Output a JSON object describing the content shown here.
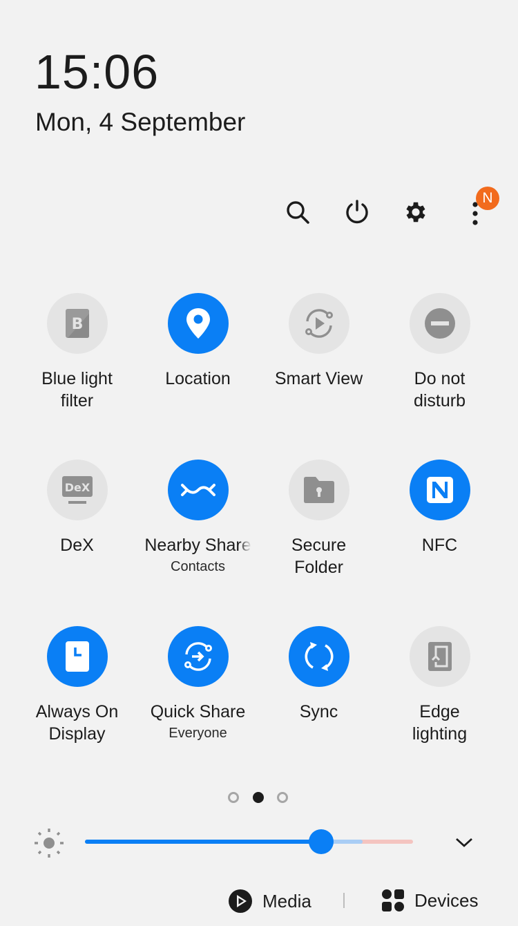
{
  "header": {
    "time": "15:06",
    "date": "Mon, 4 September"
  },
  "top_actions": [
    {
      "name": "search",
      "icon": "search-icon"
    },
    {
      "name": "power",
      "icon": "power-icon"
    },
    {
      "name": "settings",
      "icon": "gear-icon"
    },
    {
      "name": "more",
      "icon": "more-vertical-icon",
      "badge": "N"
    }
  ],
  "colors": {
    "accent": "#0a7ff5",
    "tile_off": "#e4e4e4",
    "icon_off": "#8f8f8f",
    "badge": "#f26b1d",
    "background": "#f2f2f2"
  },
  "quick_tiles": [
    {
      "label": "Blue light\nfilter",
      "sub": "",
      "state": "off",
      "icon": "blue-light-filter-icon"
    },
    {
      "label": "Location",
      "sub": "",
      "state": "on",
      "icon": "location-pin-icon"
    },
    {
      "label": "Smart View",
      "sub": "",
      "state": "off",
      "icon": "smart-view-icon"
    },
    {
      "label": "Do not\ndisturb",
      "sub": "",
      "state": "off",
      "icon": "do-not-disturb-icon"
    },
    {
      "label": "DeX",
      "sub": "",
      "state": "off",
      "icon": "dex-icon"
    },
    {
      "label": "Nearby Share",
      "sub": "Contacts",
      "state": "on",
      "icon": "nearby-share-icon"
    },
    {
      "label": "Secure\nFolder",
      "sub": "",
      "state": "off",
      "icon": "secure-folder-icon"
    },
    {
      "label": "NFC",
      "sub": "",
      "state": "on",
      "icon": "nfc-icon"
    },
    {
      "label": "Always On\nDisplay",
      "sub": "",
      "state": "on",
      "icon": "always-on-display-icon"
    },
    {
      "label": "Quick Share",
      "sub": "Everyone",
      "state": "on",
      "icon": "quick-share-icon"
    },
    {
      "label": "Sync",
      "sub": "",
      "state": "on",
      "icon": "sync-icon"
    },
    {
      "label": "Edge\nlighting",
      "sub": "",
      "state": "off",
      "icon": "edge-lighting-icon"
    }
  ],
  "pager": {
    "pages": 3,
    "current": 2
  },
  "brightness": {
    "value_fraction": 0.72,
    "icon": "brightness-icon",
    "expand_icon": "chevron-down-icon"
  },
  "bottom": {
    "media_label": "Media",
    "devices_label": "Devices"
  }
}
